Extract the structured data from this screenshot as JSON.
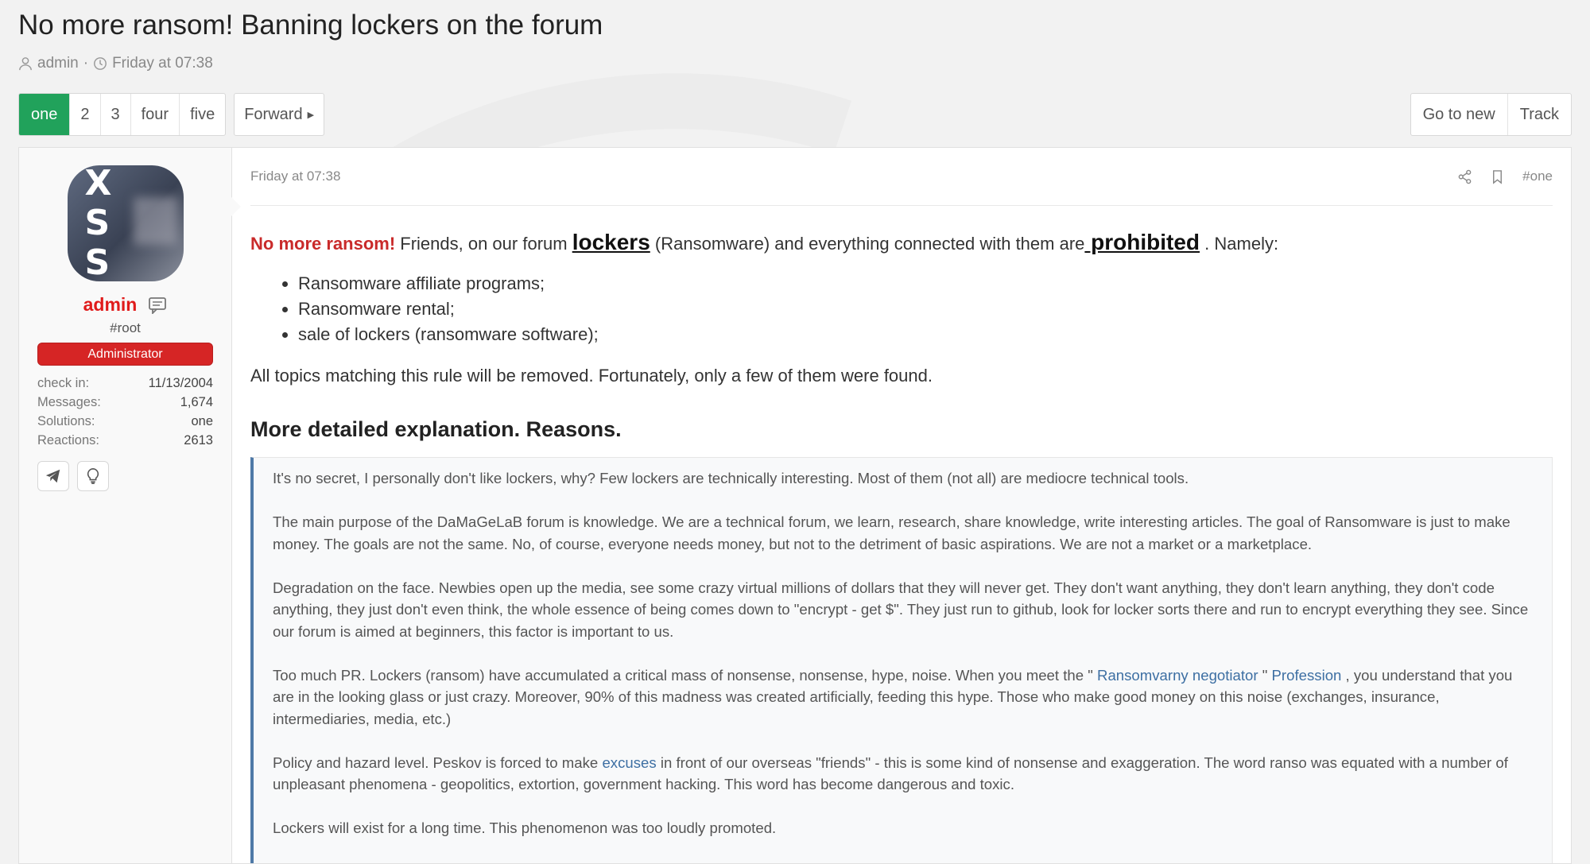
{
  "thread": {
    "title": "No more ransom! Banning lockers on the forum",
    "author": "admin",
    "separator": "·",
    "date": "Friday at 07:38"
  },
  "pagination": {
    "pages": [
      "one",
      "2",
      "3",
      "four",
      "five"
    ],
    "active_index": 0,
    "forward_label": "Forward"
  },
  "actions": {
    "go_to_new": "Go to new",
    "track": "Track"
  },
  "user": {
    "avatar_text": "XSS",
    "name": "admin",
    "title": "#root",
    "banner": "Administrator",
    "stats": [
      {
        "label": "check in:",
        "value": "11/13/2004"
      },
      {
        "label": "Messages:",
        "value": "1,674"
      },
      {
        "label": "Solutions:",
        "value": "one"
      },
      {
        "label": "Reactions:",
        "value": "2613"
      }
    ]
  },
  "post": {
    "date": "Friday at 07:38",
    "number": "#one",
    "lead": {
      "red": "No more ransom!",
      "t1": " Friends, on our forum ",
      "lockers": "lockers",
      "t2": " (Ransomware) and everything connected with them are",
      "prohibited": " prohibited",
      "t3": " . Namely:"
    },
    "list": [
      "Ransomware affiliate programs;",
      "Ransomware rental;",
      "sale of lockers (ransomware software);"
    ],
    "after_list": "All topics matching this rule will be removed. Fortunately, only a few of them were found.",
    "section_heading": "More detailed explanation. Reasons.",
    "quote": {
      "p1": "It's no secret, I personally don't like lockers, why? Few lockers are technically interesting. Most of them (not all) are mediocre technical tools.",
      "p2": "The main purpose of the DaMaGeLaB forum is knowledge. We are a technical forum, we learn, research, share knowledge, write interesting articles. The goal of Ransomware is just to make money. The goals are not the same. No, of course, everyone needs money, but not to the detriment of basic aspirations. We are not a market or a marketplace.",
      "p3": "Degradation on the face. Newbies open up the media, see some crazy virtual millions of dollars that they will never get. They don't want anything, they don't learn anything, they don't code anything, they just don't even think, the whole essence of being comes down to \"encrypt - get $\". They just run to github, look for locker sorts there and run to encrypt everything they see. Since our forum is aimed at beginners, this factor is important to us.",
      "p4_a": "Too much PR. Lockers (ransom) have accumulated a critical mass of nonsense, nonsense, hype, noise. When you meet the \" ",
      "p4_link1": "Ransomvarny negotiator",
      "p4_b": " \" ",
      "p4_link2": "Profession",
      "p4_c": " , you understand that you are in the looking glass or just crazy. Moreover, 90% of this madness was created artificially, feeding this hype. Those who make good money on this noise (exchanges, insurance, intermediaries, media, etc.)",
      "p5_a": "Policy and hazard level. Peskov is forced to make ",
      "p5_link": "excuses",
      "p5_b": " in front of our overseas \"friends\" - this is some kind of nonsense and exaggeration. The word ranso was equated with a number of unpleasant phenomena - geopolitics, extortion, government hacking. This word has become dangerous and toxic.",
      "p6": "Lockers will exist for a long time. This phenomenon was too loudly promoted."
    }
  },
  "colors": {
    "accent_green": "#21a25b",
    "admin_red": "#e01b1b",
    "banner_red": "#d62525",
    "quote_border": "#4e79a7",
    "link": "#3d6fa3"
  }
}
